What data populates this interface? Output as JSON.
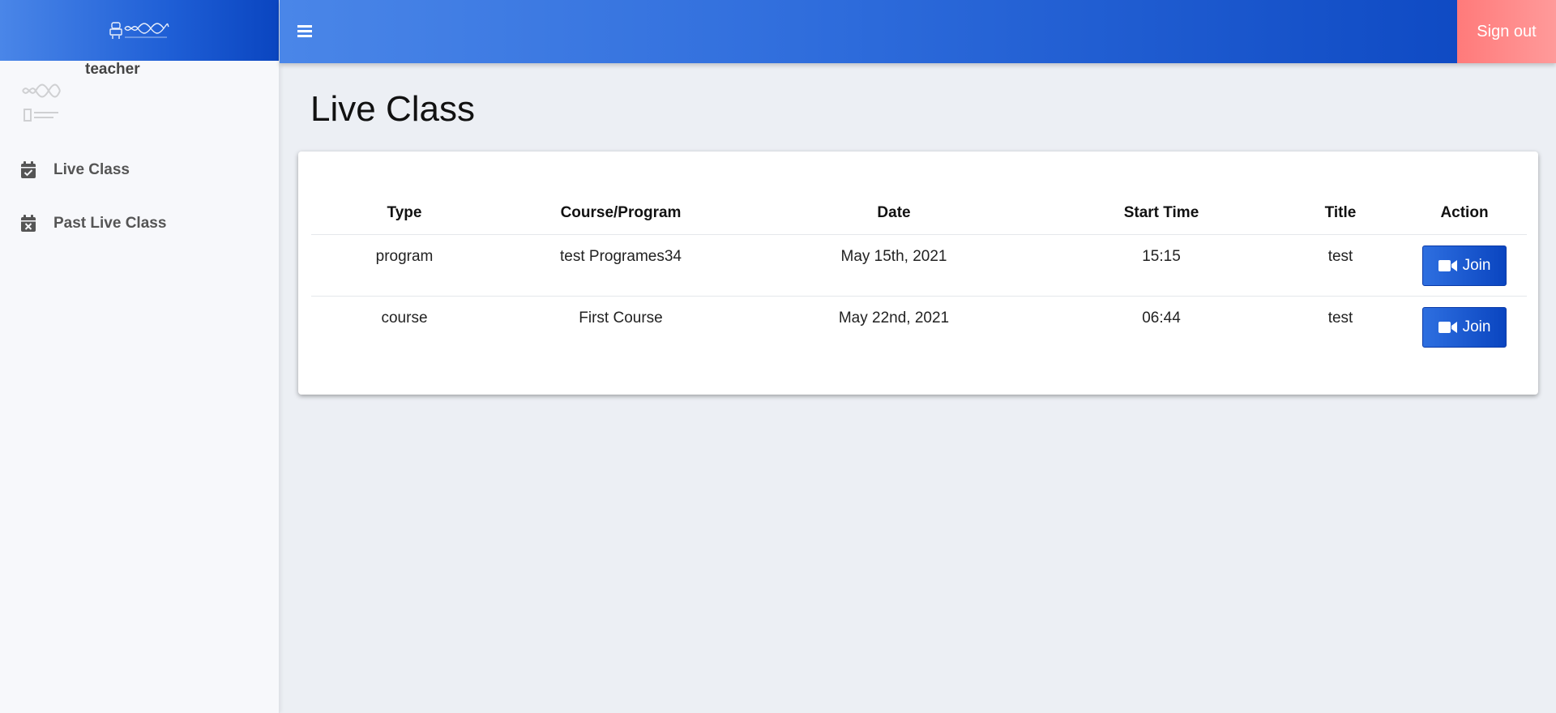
{
  "header": {
    "signout_label": "Sign out"
  },
  "sidebar": {
    "user_name": "teacher",
    "items": [
      {
        "label": "Live Class",
        "icon": "calendar-check-icon"
      },
      {
        "label": "Past Live Class",
        "icon": "calendar-times-icon"
      }
    ]
  },
  "main": {
    "title": "Live Class",
    "table": {
      "headers": [
        "Type",
        "Course/Program",
        "Date",
        "Start Time",
        "Title",
        "Action"
      ],
      "rows": [
        {
          "type": "program",
          "course": "test Programes34",
          "date": "May 15th, 2021",
          "start_time": "15:15",
          "title": "test",
          "action": "Join"
        },
        {
          "type": "course",
          "course": "First Course",
          "date": "May 22nd, 2021",
          "start_time": "06:44",
          "title": "test",
          "action": "Join"
        }
      ]
    }
  },
  "colors": {
    "brand_start": "#4a86e8",
    "brand_end": "#0a45c0",
    "signout": "#ff8a8a",
    "join_button": "#1f5fd6"
  }
}
